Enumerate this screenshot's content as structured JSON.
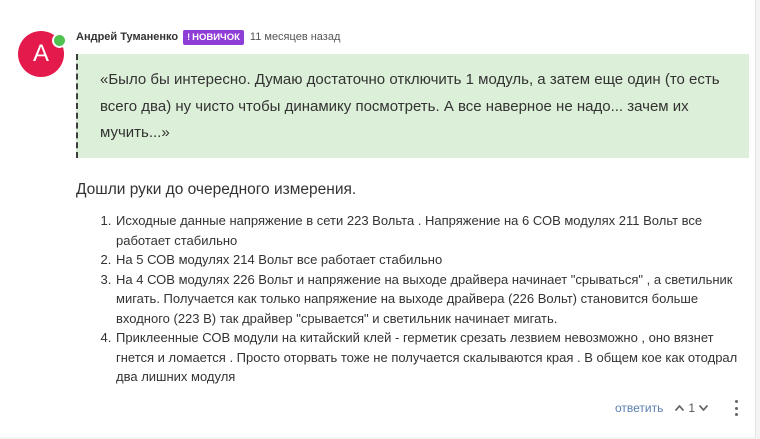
{
  "comment": {
    "avatar_letter": "A",
    "author": "Андрей Туманенко",
    "badge_icon": "!",
    "badge": "НОВИЧОК",
    "time": "11 месяцев назад",
    "quote": "«Было бы интересно. Думаю достаточно отключить 1 модуль, а затем еще один (то есть всего два) ну чисто чтобы динамику посмотреть. А все наверное не надо... зачем их мучить...»",
    "intro": "Дошли руки до очередного измерения.",
    "items": [
      "Исходные данные напряжение в сети 223 Вольта . Напряжение на 6 СОВ модулях 211 Вольт все работает стабильно",
      "На 5 СОВ модулях 214 Вольт все работает стабильно",
      "На 4 СОВ модулях 226 Вольт и напряжение на выходе драйвера начинает \"срываться\" , а светильник мигать. Получается как только напряжение на выходе драйвера (226 Вольт) становится больше входного (223 В) так драйвер \"срывается\" и светильник начинает мигать.",
      "Приклеенные СОВ модули на китайский клей - герметик срезать лезвием невозможно , оно вязнет гнется и ломается . Просто оторвать тоже не получается скалываются края . В общем кое как отодрал два лишних модуля"
    ],
    "actions": {
      "reply": "ответить",
      "upvote_icon": "chevron-up-icon",
      "vote_count": "1",
      "downvote_icon": "chevron-down-icon",
      "more_icon": "more-vertical-icon"
    }
  },
  "colors": {
    "avatar": "#e4194c",
    "online": "#4fc24f",
    "badge": "#8e3ed6",
    "quote_bg": "#dcefd8",
    "reply_link": "#5a7fb0"
  }
}
